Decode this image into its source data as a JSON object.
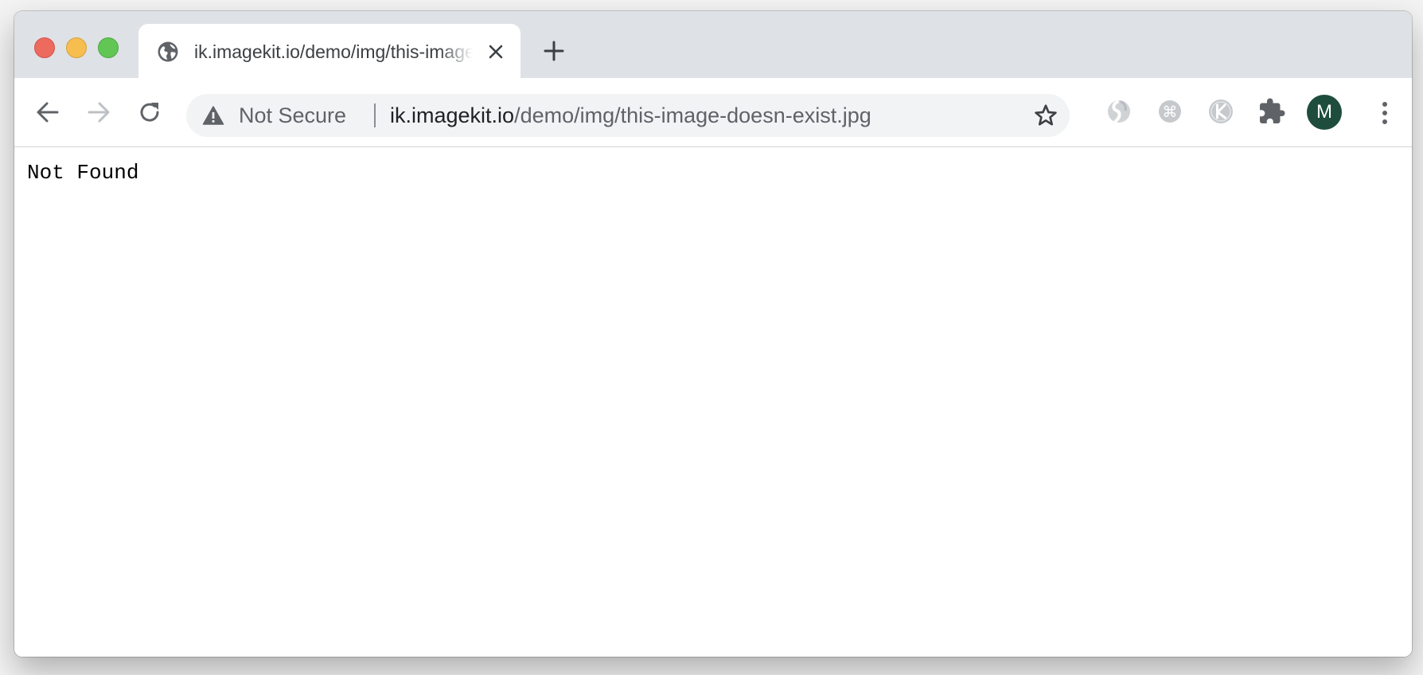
{
  "window": {
    "traffic_lights": {
      "close": "#ed6a5e",
      "minimize": "#f5be4f",
      "zoom": "#62c655"
    }
  },
  "tab": {
    "title": "ik.imagekit.io/demo/img/this-image-doesn-exist.jpg",
    "favicon": "globe-icon"
  },
  "toolbar": {
    "security_label": "Not Secure",
    "url_host": "ik.imagekit.io",
    "url_path": "/demo/img/this-image-doesn-exist.jpg",
    "extensions": [
      "simplenote-icon",
      "shortcut-icon",
      "k-icon",
      "puzzle-icon"
    ],
    "avatar_initial": "M",
    "avatar_color": "#1e4d3e"
  },
  "page": {
    "body_text": "Not Found"
  }
}
